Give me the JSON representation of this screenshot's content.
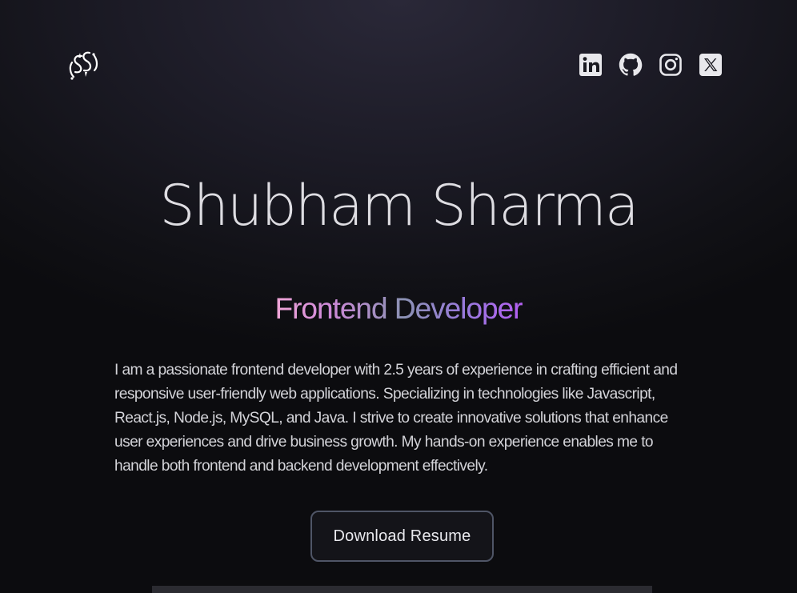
{
  "header": {
    "logo_alt": "SS",
    "social": [
      {
        "name": "LinkedIn",
        "icon": "linkedin-icon"
      },
      {
        "name": "GitHub",
        "icon": "github-icon"
      },
      {
        "name": "Instagram",
        "icon": "instagram-icon"
      },
      {
        "name": "X",
        "icon": "x-icon"
      }
    ]
  },
  "hero": {
    "name": "Shubham Sharma",
    "role": "Frontend Developer",
    "bio": "I am a passionate frontend developer with 2.5 years of experience in crafting efficient and responsive user-friendly web applications. Specializing in technologies like Javascript, React.js, Node.js, MySQL, and Java. I strive to create innovative solutions that enhance user experiences and drive business growth. My hands-on experience enables me to handle both frontend and backend development effectively.",
    "resume_label": "Download Resume"
  },
  "colors": {
    "background": "#16151d",
    "text": "#dedde2",
    "role_gradient_start": "#f0a6d6",
    "role_gradient_mid": "#8b92b4",
    "role_gradient_end": "#b45df2",
    "button_border": "#4f5566"
  }
}
